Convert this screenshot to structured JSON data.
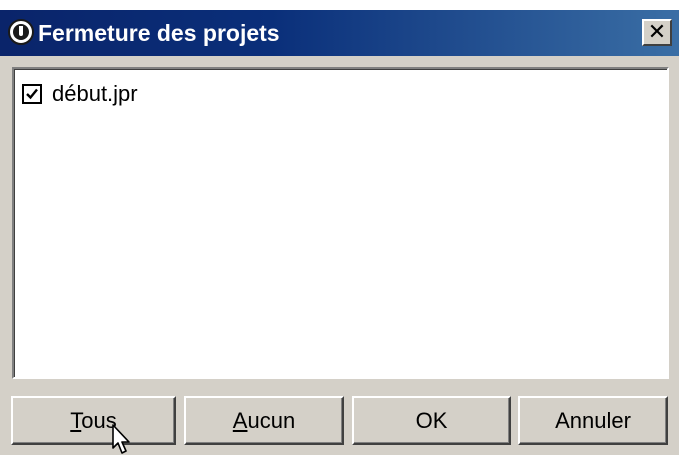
{
  "window": {
    "title": "Fermeture des projets",
    "close_glyph": "✕"
  },
  "icons": {
    "app": "app-logo-icon",
    "close": "close-icon",
    "check": "checkmark-icon",
    "cursor": "mouse-pointer-icon"
  },
  "list": {
    "items": [
      {
        "label": "début.jpr",
        "checked": true
      }
    ]
  },
  "buttons": {
    "tous": {
      "accel": "T",
      "rest": "ous"
    },
    "aucun": {
      "accel": "A",
      "rest": "ucun"
    },
    "ok": {
      "label": "OK"
    },
    "annuler": {
      "label": "Annuler"
    }
  },
  "colors": {
    "titlebar_start": "#0a246a",
    "titlebar_end": "#3a6ea5",
    "dialog_bg": "#d4d0c8"
  }
}
